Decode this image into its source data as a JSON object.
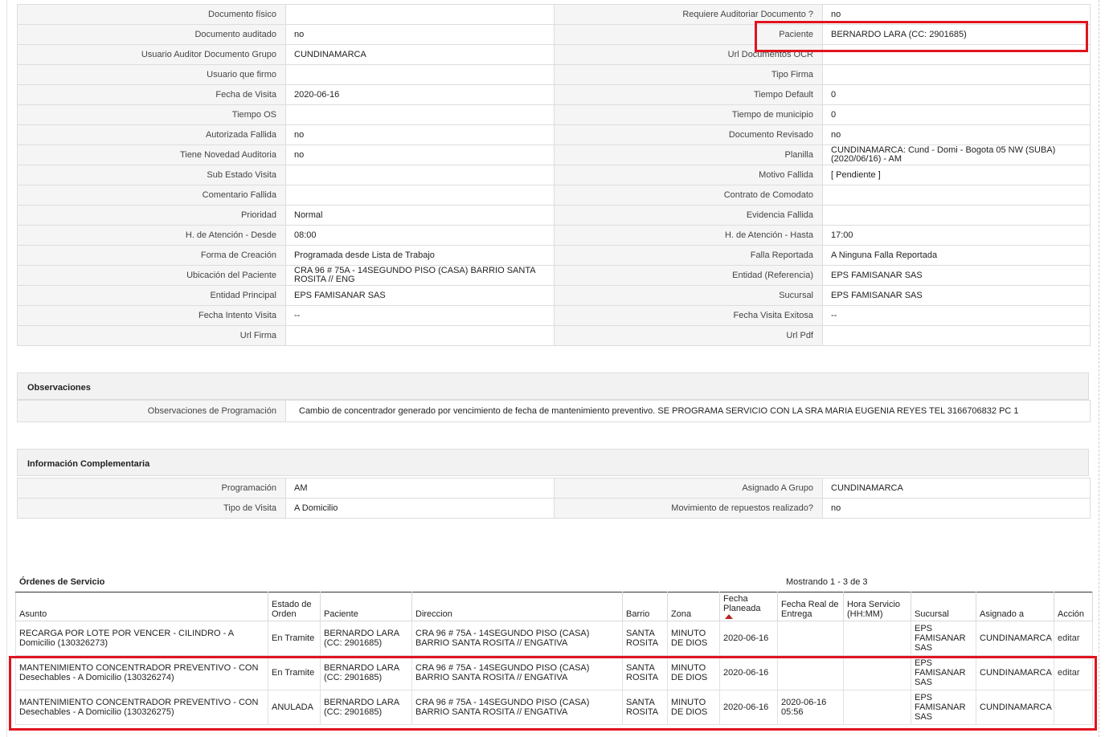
{
  "details": [
    {
      "l1": "Documento físico",
      "v1": "",
      "l2": "Requiere Auditoriar Documento ?",
      "v2": "no"
    },
    {
      "l1": "Documento auditado",
      "v1": "no",
      "l2": "Paciente",
      "v2": "BERNARDO LARA (CC: 2901685)"
    },
    {
      "l1": "Usuario Auditor Documento Grupo",
      "v1": "CUNDINAMARCA",
      "l2": "Url Documentos OCR",
      "v2": ""
    },
    {
      "l1": "Usuario que firmo",
      "v1": "",
      "l2": "Tipo Firma",
      "v2": ""
    },
    {
      "l1": "Fecha de Visita",
      "v1": "2020-06-16",
      "l2": "Tiempo Default",
      "v2": "0"
    },
    {
      "l1": "Tiempo OS",
      "v1": "",
      "l2": "Tiempo de municipio",
      "v2": "0"
    },
    {
      "l1": "Autorizada Fallida",
      "v1": "no",
      "l2": "Documento Revisado",
      "v2": "no"
    },
    {
      "l1": "Tiene Novedad Auditoria",
      "v1": "no",
      "l2": "Planilla",
      "v2": "CUNDINAMARCA: Cund - Domi - Bogota 05 NW (SUBA) (2020/06/16) - AM"
    },
    {
      "l1": "Sub Estado Visita",
      "v1": "",
      "l2": "Motivo Fallida",
      "v2": "[ Pendiente ]"
    },
    {
      "l1": "Comentario Fallida",
      "v1": "",
      "l2": "Contrato de Comodato",
      "v2": ""
    },
    {
      "l1": "Prioridad",
      "v1": "Normal",
      "l2": "Evidencia Fallida",
      "v2": ""
    },
    {
      "l1": "H. de Atención - Desde",
      "v1": "08:00",
      "l2": "H. de Atención - Hasta",
      "v2": "17:00"
    },
    {
      "l1": "Forma de Creación",
      "v1": "Programada desde Lista de Trabajo",
      "l2": "Falla Reportada",
      "v2": "A Ninguna Falla Reportada"
    },
    {
      "l1": "Ubicación del Paciente",
      "v1": "CRA 96 # 75A - 14SEGUNDO PISO (CASA) BARRIO SANTA ROSITA // ENG",
      "l2": "Entidad (Referencia)",
      "v2": "EPS FAMISANAR SAS"
    },
    {
      "l1": "Entidad Principal",
      "v1": "EPS FAMISANAR SAS",
      "l2": "Sucursal",
      "v2": "EPS FAMISANAR SAS"
    },
    {
      "l1": "Fecha Intento Visita",
      "v1": "--",
      "l2": "Fecha Visita Exitosa",
      "v2": "--"
    },
    {
      "l1": "Url Firma",
      "v1": "",
      "l2": "Url Pdf",
      "v2": ""
    }
  ],
  "observaciones": {
    "title": "Observaciones",
    "label": "Observaciones de Programación",
    "value": "Cambio de concentrador generado por vencimiento de fecha de mantenimiento preventivo. SE PROGRAMA SERVICIO CON LA SRA MARIA EUGENIA REYES TEL 3166706832 PC 1"
  },
  "complementaria": {
    "title": "Información Complementaria",
    "rows": [
      {
        "l1": "Programación",
        "v1": "AM",
        "l2": "Asignado A Grupo",
        "v2": "CUNDINAMARCA"
      },
      {
        "l1": "Tipo de Visita",
        "v1": "A Domicilio",
        "l2": "Movimiento de repuestos realizado?",
        "v2": "no"
      }
    ]
  },
  "orders": {
    "title": "Órdenes de Servicio",
    "count": "Mostrando 1 - 3 de 3",
    "headers": [
      "Asunto",
      "Estado de Orden",
      "Paciente",
      "Direccion",
      "Barrio",
      "Zona",
      "Fecha Planeada",
      "Fecha Real de Entrega",
      "Hora Servicio (HH:MM)",
      "Sucursal",
      "Asignado a",
      "Acción"
    ],
    "rows": [
      [
        "RECARGA POR LOTE POR VENCER - CILINDRO - A Domicilio (130326273)",
        "En Tramite",
        "BERNARDO LARA (CC: 2901685)",
        "CRA 96 # 75A - 14SEGUNDO PISO (CASA) BARRIO SANTA ROSITA // ENGATIVA",
        "SANTA ROSITA",
        "MINUTO DE DIOS",
        "2020-06-16",
        "",
        "",
        "EPS FAMISANAR SAS",
        "CUNDINAMARCA",
        "editar"
      ],
      [
        "MANTENIMIENTO CONCENTRADOR PREVENTIVO - CON Desechables - A Domicilio (130326274)",
        "En Tramite",
        "BERNARDO LARA (CC: 2901685)",
        "CRA 96 # 75A - 14SEGUNDO PISO (CASA) BARRIO SANTA ROSITA // ENGATIVA",
        "SANTA ROSITA",
        "MINUTO DE DIOS",
        "2020-06-16",
        "",
        "",
        "EPS FAMISANAR SAS",
        "CUNDINAMARCA",
        "editar"
      ],
      [
        "MANTENIMIENTO CONCENTRADOR PREVENTIVO - CON Desechables - A Domicilio (130326275)",
        "ANULADA",
        "BERNARDO LARA (CC: 2901685)",
        "CRA 96 # 75A - 14SEGUNDO PISO (CASA) BARRIO SANTA ROSITA // ENGATIVA",
        "SANTA ROSITA",
        "MINUTO DE DIOS",
        "2020-06-16",
        "2020-06-16 05:56",
        "",
        "EPS FAMISANAR SAS",
        "CUNDINAMARCA",
        ""
      ]
    ]
  },
  "highlight_color": "#e0141f"
}
